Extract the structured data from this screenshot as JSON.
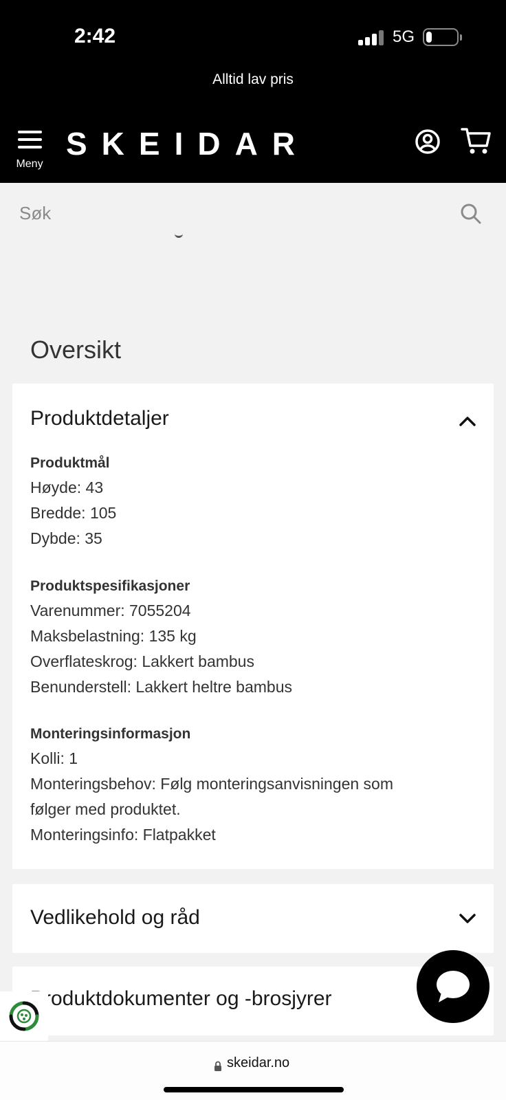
{
  "status_bar": {
    "time": "2:42",
    "network": "5G",
    "battery_level": 0.2
  },
  "promo": {
    "text": "Alltid lav pris"
  },
  "header": {
    "menu_label": "Meny",
    "logo": "SKEIDAR",
    "icons": [
      "hamburger-menu-icon",
      "user-account-icon",
      "shopping-cart-icon"
    ]
  },
  "search": {
    "placeholder": "Søk",
    "value": "",
    "icon": "search-icon"
  },
  "overview": {
    "title": "Oversikt"
  },
  "product_details": {
    "title": "Produktdetaljer",
    "expanded": true,
    "sections": [
      {
        "heading": "Produktmål",
        "lines": [
          "Høyde: 43",
          "Bredde: 105",
          "Dybde: 35"
        ]
      },
      {
        "heading": "Produktspesifikasjoner",
        "lines": [
          "Varenummer: 7055204",
          "Maksbelastning: 135 kg",
          "Overflateskrog: Lakkert bambus",
          "Benunderstell: Lakkert heltre bambus"
        ]
      },
      {
        "heading": "Monteringsinformasjon",
        "lines": [
          "Kolli: 1",
          "Monteringsbehov: Følg monteringsanvisningen som",
          "følger med produktet.",
          "Monteringsinfo: Flatpakket"
        ]
      }
    ]
  },
  "care": {
    "title": "Vedlikehold og råd",
    "expanded": false
  },
  "documents": {
    "title": "Produktdokumenter og -brosjyrer"
  },
  "chat": {
    "icon": "chat-bubble-icon"
  },
  "eco_badge": {
    "icon": "recycle-badge-icon"
  },
  "browser": {
    "url": "skeidar.no"
  },
  "colors": {
    "header_bg": "#000000",
    "page_bg": "#f2f2f2",
    "card_bg": "#ffffff",
    "text": "#222222"
  }
}
